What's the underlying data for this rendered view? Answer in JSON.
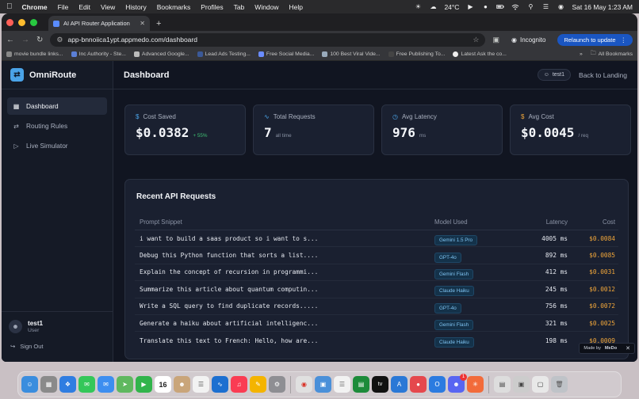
{
  "menubar": {
    "items": [
      "Chrome",
      "File",
      "Edit",
      "View",
      "History",
      "Bookmarks",
      "Profiles",
      "Tab",
      "Window",
      "Help"
    ],
    "weather": "24°C",
    "clock": "Sat 16 May  1:23 AM"
  },
  "browser": {
    "tab_title": "AI API Router Application",
    "url": "app-bnnoiica1ypt.appmedo.com/dashboard",
    "incognito_label": "Incognito",
    "relaunch_label": "Relaunch to update",
    "bookmarks": [
      "movie bundle links...",
      "Inc Authority - Ste...",
      "Advanced Google...",
      "Lead Ads Testing...",
      "Free Social Media...",
      "100 Best Viral Vide...",
      "Free Publishing To...",
      "Latest Ask the co..."
    ],
    "all_bookmarks_label": "All Bookmarks"
  },
  "app": {
    "brand": "OmniRoute",
    "nav": [
      {
        "label": "Dashboard",
        "icon": "grid-icon"
      },
      {
        "label": "Routing Rules",
        "icon": "routing-icon"
      },
      {
        "label": "Live Simulator",
        "icon": "play-icon"
      }
    ],
    "user": {
      "name": "test1",
      "role": "User",
      "signout_label": "Sign Out"
    },
    "page_title": "Dashboard",
    "user_chip": "test1",
    "back_label": "Back to Landing",
    "stats": [
      {
        "label": "Cost Saved",
        "icon": "dollar-icon",
        "value": "$0.0382",
        "sub": "+ 55%",
        "sub_color": "green"
      },
      {
        "label": "Total Requests",
        "icon": "activity-icon",
        "value": "7",
        "sub": "all time",
        "sub_color": "muted"
      },
      {
        "label": "Avg Latency",
        "icon": "clock-icon",
        "value": "976",
        "sub": "ms",
        "sub_color": "muted"
      },
      {
        "label": "Avg Cost",
        "icon": "dollar-icon",
        "value": "$0.0045",
        "sub": "/ req",
        "sub_color": "muted"
      }
    ],
    "recent": {
      "title": "Recent API Requests",
      "headers": [
        "Prompt Snippet",
        "Model Used",
        "Latency",
        "Cost"
      ],
      "rows": [
        {
          "prompt": "i want to build a saas product so i want to s...",
          "model": "Gemini 1.5 Pro",
          "latency": "4005 ms",
          "cost": "$0.0084"
        },
        {
          "prompt": "Debug this Python function that sorts a list....",
          "model": "GPT-4o",
          "latency": "892 ms",
          "cost": "$0.0085"
        },
        {
          "prompt": "Explain the concept of recursion in programmi...",
          "model": "Gemini Flash",
          "latency": "412 ms",
          "cost": "$0.0031"
        },
        {
          "prompt": "Summarize this article about quantum computin...",
          "model": "Claude Haiku",
          "latency": "245 ms",
          "cost": "$0.0012"
        },
        {
          "prompt": "Write a SQL query to find duplicate records.....",
          "model": "GPT-4o",
          "latency": "756 ms",
          "cost": "$0.0072"
        },
        {
          "prompt": "Generate a haiku about artificial intelligenc...",
          "model": "Gemini Flash",
          "latency": "321 ms",
          "cost": "$0.0025"
        },
        {
          "prompt": "Translate this text to French: Hello, how are...",
          "model": "Claude Haiku",
          "latency": "198 ms",
          "cost": "$0.0009"
        }
      ]
    },
    "made_by": "Made by",
    "made_by_brand": "MeDo"
  },
  "dock": {
    "calendar_day": "16",
    "badge_count": "1"
  },
  "colors": {
    "accent": "#4aa3e8",
    "cost": "#f0a63a",
    "positive": "#3fbf72",
    "background": "#111521"
  }
}
